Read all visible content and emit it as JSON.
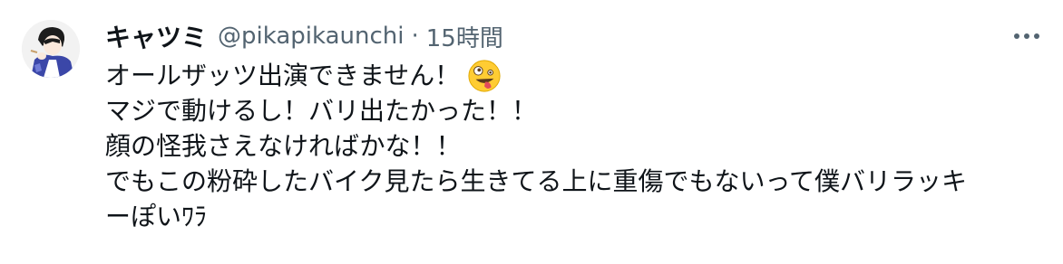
{
  "author": {
    "display_name": "キャツミ",
    "handle": "@pikapikaunchi",
    "separator": "·",
    "timestamp": "15時間"
  },
  "tweet": {
    "lines": [
      "オールザッツ出演できません！",
      "マジで動けるし！バリ出たかった！！",
      "顔の怪我さえなければかな！！",
      "でもこの粉砕したバイク見たら生きてる上に重傷でもないって僕バリラッキ",
      "ーぽいﾜﾗ"
    ],
    "emoji_icon": "zany-face-emoji"
  },
  "actions": {
    "more_icon": "more-options-icon"
  },
  "colors": {
    "text": "#0f1419",
    "secondary": "#536471",
    "emoji_face": "#ffcc33",
    "emoji_tongue": "#e24b5b"
  }
}
